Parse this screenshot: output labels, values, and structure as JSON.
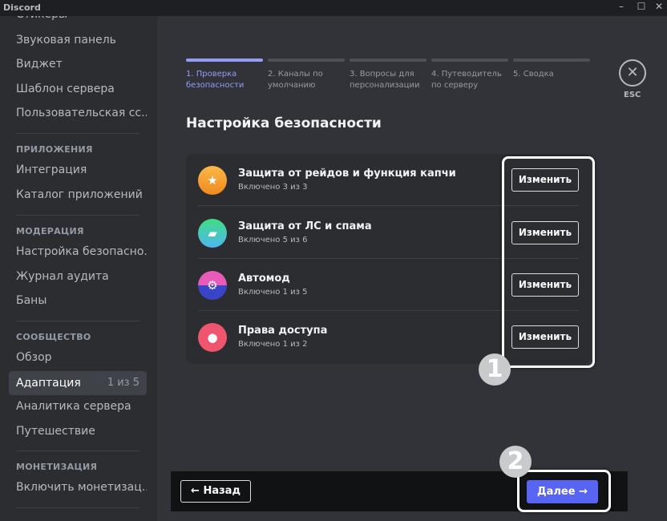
{
  "window": {
    "app_name": "Discord",
    "minimize": "–",
    "maximize": "☐",
    "close": "✕"
  },
  "sidebar": {
    "items": [
      {
        "label": "Стикеры"
      },
      {
        "label": "Звуковая панель"
      },
      {
        "label": "Виджет"
      },
      {
        "label": "Шаблон сервера"
      },
      {
        "label": "Пользовательская сс..."
      },
      {
        "label": "Интеграция"
      },
      {
        "label": "Каталог приложений"
      },
      {
        "label": "Настройка безопасно..."
      },
      {
        "label": "Журнал аудита"
      },
      {
        "label": "Баны"
      },
      {
        "label": "Обзор"
      },
      {
        "label": "Адаптация",
        "badge": "1 из 5",
        "selected": true
      },
      {
        "label": "Аналитика сервера"
      },
      {
        "label": "Путешествие"
      },
      {
        "label": "Включить монетизац..."
      }
    ],
    "headers": [
      "ПРИЛОЖЕНИЯ",
      "МОДЕРАЦИЯ",
      "СООБЩЕСТВО",
      "МОНЕТИЗАЦИЯ"
    ]
  },
  "steps": [
    {
      "label": "1. Проверка безопасности",
      "active": true
    },
    {
      "label": "2. Каналы по умолчанию"
    },
    {
      "label": "3. Вопросы для персонализации"
    },
    {
      "label": "4. Путеводитель по серверу"
    },
    {
      "label": "5. Сводка"
    }
  ],
  "esc": {
    "label": "ESC",
    "icon": "close-icon"
  },
  "main": {
    "title": "Настройка безопасности",
    "rows": [
      {
        "title": "Защита от рейдов и функция капчи",
        "status": "Включено 3 из 3",
        "button": "Изменить",
        "icon": "shield-star-icon",
        "color": "#f0a81e"
      },
      {
        "title": "Защита от ЛС и спама",
        "status": "Включено 5 из 6",
        "button": "Изменить",
        "icon": "chat-bubble-icon",
        "color": "#3fcf9a"
      },
      {
        "title": "Автомод",
        "status": "Включено 1 из 5",
        "button": "Изменить",
        "icon": "automod-robot-icon",
        "color": "#e85bb8"
      },
      {
        "title": "Права доступа",
        "status": "Включено 1 из 2",
        "button": "Изменить",
        "icon": "shield-user-icon",
        "color": "#f0556e"
      }
    ]
  },
  "annotations": [
    "1",
    "2"
  ],
  "footer": {
    "back": "← Назад",
    "next": "Далее →"
  },
  "colors": {
    "accent": "#5865f2",
    "step_active": "#949cf7"
  }
}
